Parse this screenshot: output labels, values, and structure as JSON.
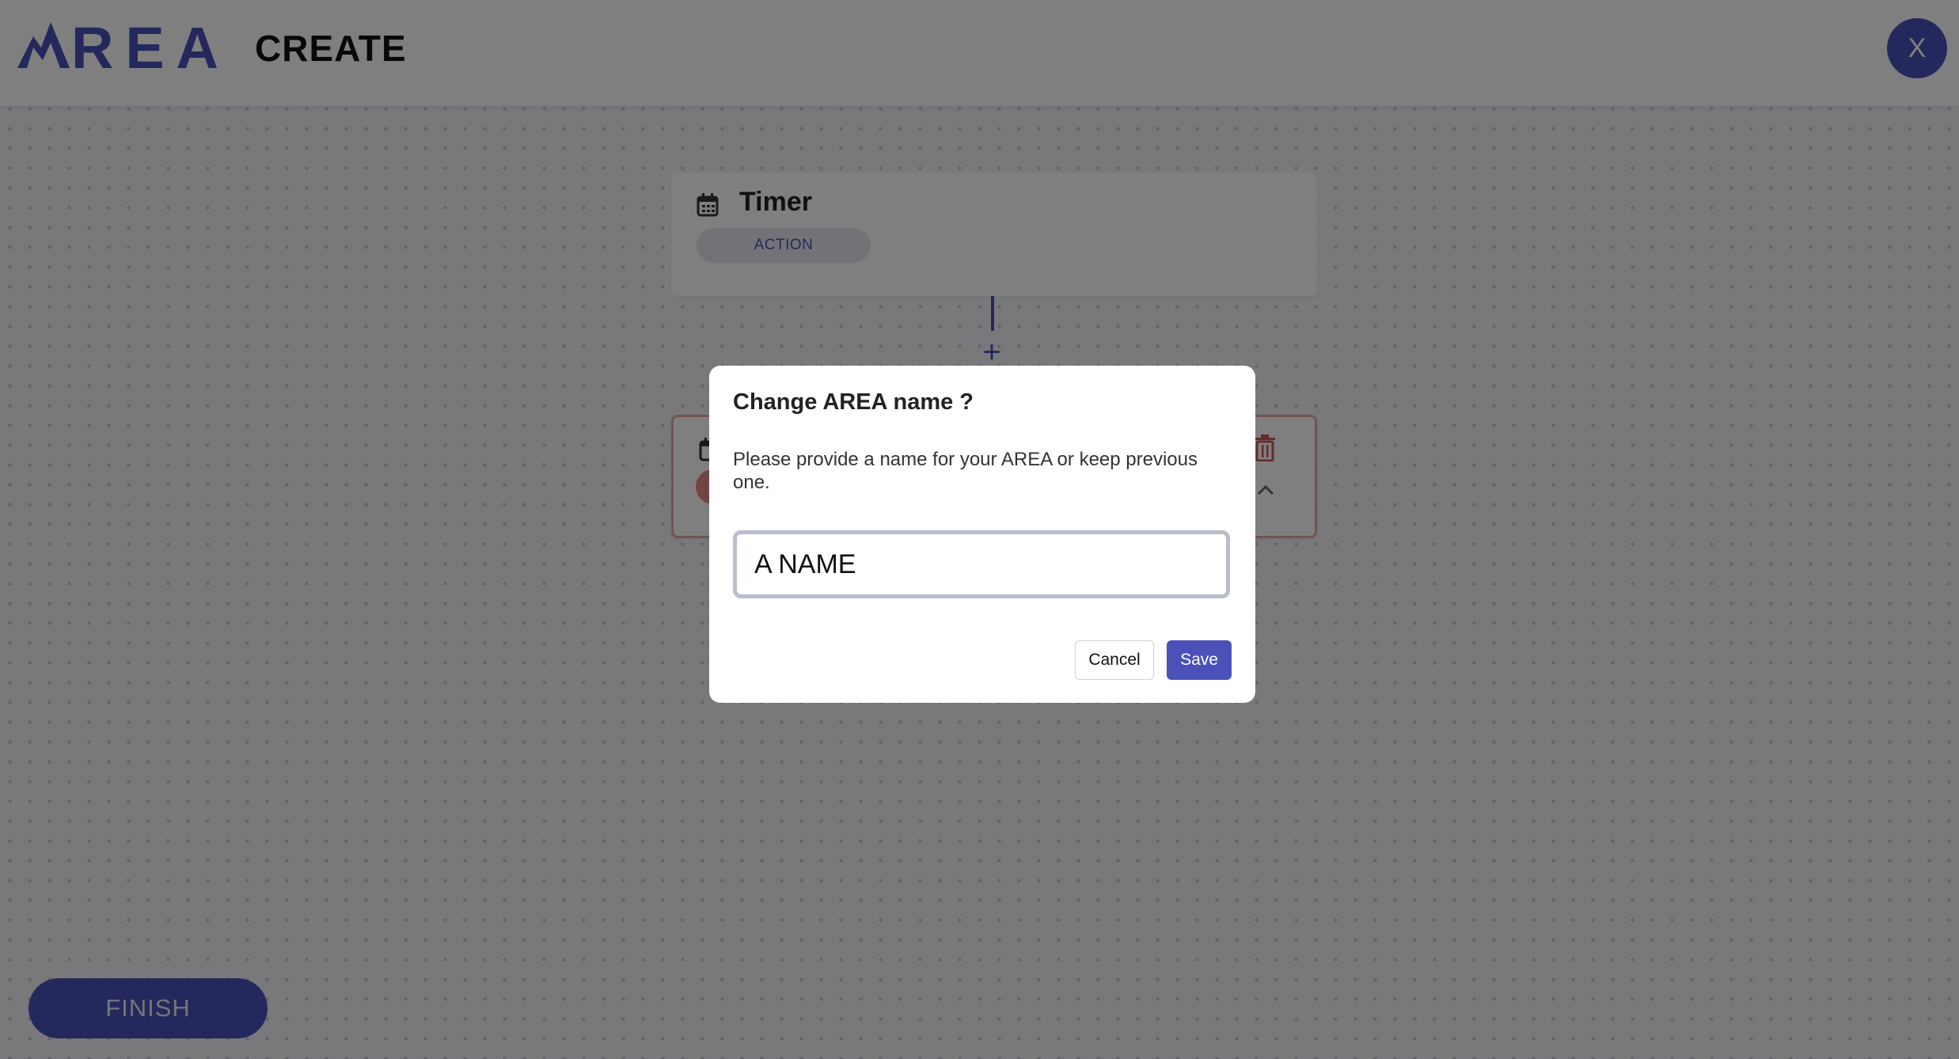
{
  "header": {
    "logo_text": "AREA",
    "title": "CREATE",
    "close_label": "X"
  },
  "workflow": {
    "action_card": {
      "icon": "calendar-icon",
      "title": "Timer",
      "badge": "ACTION"
    },
    "reaction_card": {
      "icon": "calendar-icon",
      "status_color": "#e68888"
    },
    "add_step_label": "+"
  },
  "footer": {
    "finish_label": "FINISH"
  },
  "dialog": {
    "title": "Change AREA name ?",
    "description": "Please provide a name for your AREA or keep previous one.",
    "input_value": "A NAME",
    "cancel_label": "Cancel",
    "save_label": "Save"
  },
  "colors": {
    "accent": "#4b51b9",
    "error_border": "#e8a7a7"
  }
}
